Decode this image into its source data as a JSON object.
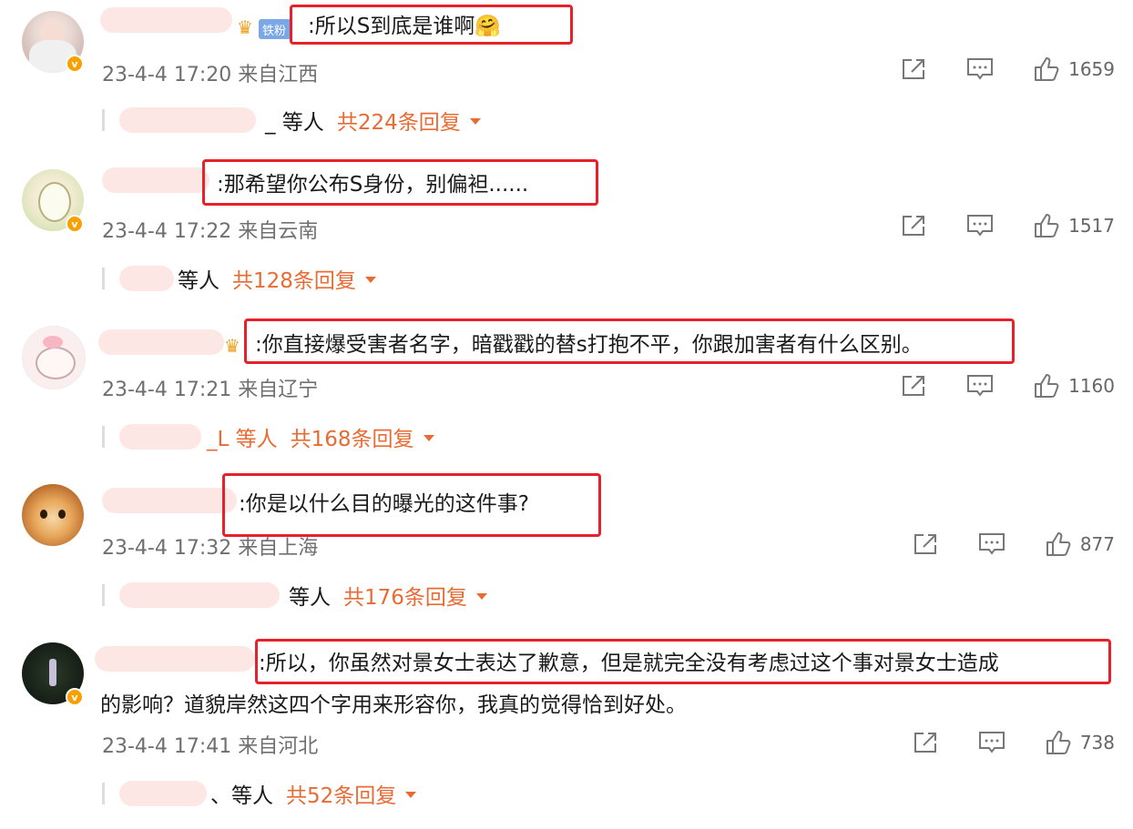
{
  "comments": [
    {
      "text": ":所以S到底是谁啊",
      "emoji": "🤗",
      "badge": "铁粉",
      "time": "23-4-4 17:20 来自江西",
      "likes": "1659",
      "reply_who": "_ 等人",
      "reply_count": "共224条回复"
    },
    {
      "text": ":那希望你公布S身份，别偏袒......",
      "time": "23-4-4 17:22 来自云南",
      "likes": "1517",
      "reply_who": "等人",
      "reply_count": "共128条回复"
    },
    {
      "text": ":你直接爆受害者名字，暗戳戳的替s打抱不平，你跟加害者有什么区别。",
      "time": "23-4-4 17:21 来自辽宁",
      "likes": "1160",
      "reply_who": "_L 等人",
      "reply_count": "共168条回复"
    },
    {
      "text": ":你是以什么目的曝光的这件事?",
      "time": "23-4-4 17:32 来自上海",
      "likes": "877",
      "reply_who": "等人",
      "reply_count": "共176条回复"
    },
    {
      "text": ":所以，你虽然对景女士表达了歉意，但是就完全没有考虑过这个事对景女士造成",
      "text2": "的影响？道貌岸然这四个字用来形容你，我真的觉得恰到好处。",
      "time": "23-4-4 17:41 来自河北",
      "likes": "738",
      "reply_who": "、等人",
      "reply_count": "共52条回复"
    }
  ],
  "icons": {
    "share": "share-icon",
    "comment": "comment-icon",
    "like": "like-icon"
  },
  "colors": {
    "highlight": "#e8202a",
    "accent": "#e86b34",
    "meta": "#6f6f6f"
  }
}
